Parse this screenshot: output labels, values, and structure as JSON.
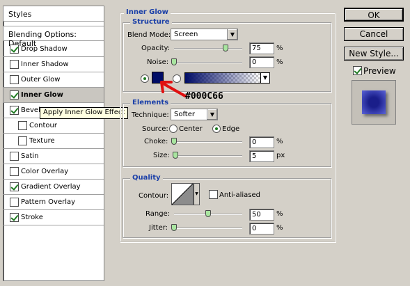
{
  "styles_panel": {
    "header": "Styles",
    "blending": "Blending Options: Default",
    "items": [
      {
        "label": "Drop Shadow",
        "checked": true
      },
      {
        "label": "Inner Shadow",
        "checked": false
      },
      {
        "label": "Outer Glow",
        "checked": false
      },
      {
        "label": "Inner Glow",
        "checked": true
      },
      {
        "label": "Bevel and Emboss",
        "checked": true
      },
      {
        "label": "Contour",
        "checked": false
      },
      {
        "label": "Texture",
        "checked": false
      },
      {
        "label": "Satin",
        "checked": false
      },
      {
        "label": "Color Overlay",
        "checked": false
      },
      {
        "label": "Gradient Overlay",
        "checked": true
      },
      {
        "label": "Pattern Overlay",
        "checked": false
      },
      {
        "label": "Stroke",
        "checked": true
      }
    ],
    "bevel_visible_label": "Bevel"
  },
  "tooltip": "Apply Inner Glow Effect",
  "inner_glow": {
    "title": "Inner Glow",
    "structure": {
      "title": "Structure",
      "blend_mode_label": "Blend Mode:",
      "blend_mode": "Screen",
      "opacity_label": "Opacity:",
      "opacity": "75",
      "opacity_value": 75,
      "noise_label": "Noise:",
      "noise": "0",
      "noise_value": 0,
      "percent": "%",
      "color_hex": "#000C66"
    },
    "elements": {
      "title": "Elements",
      "technique_label": "Technique:",
      "technique": "Softer",
      "source_label": "Source:",
      "center_label": "Center",
      "edge_label": "Edge",
      "choke_label": "Choke:",
      "choke": "0",
      "choke_value": 0,
      "size_label": "Size:",
      "size": "5",
      "size_value": 5,
      "percent": "%",
      "px": "px"
    },
    "quality": {
      "title": "Quality",
      "contour_label": "Contour:",
      "anti_aliased_label": "Anti-aliased",
      "range_label": "Range:",
      "range": "50",
      "range_value": 50,
      "jitter_label": "Jitter:",
      "jitter": "0",
      "jitter_value": 0,
      "percent": "%"
    }
  },
  "annotation": "#000C66",
  "buttons": {
    "ok": "OK",
    "cancel": "Cancel",
    "new_style": "New Style...",
    "preview": "Preview"
  },
  "colors": {
    "glow_color": "#000C66",
    "arrow": "#e01010",
    "title_blue": "#1a3fa8"
  }
}
